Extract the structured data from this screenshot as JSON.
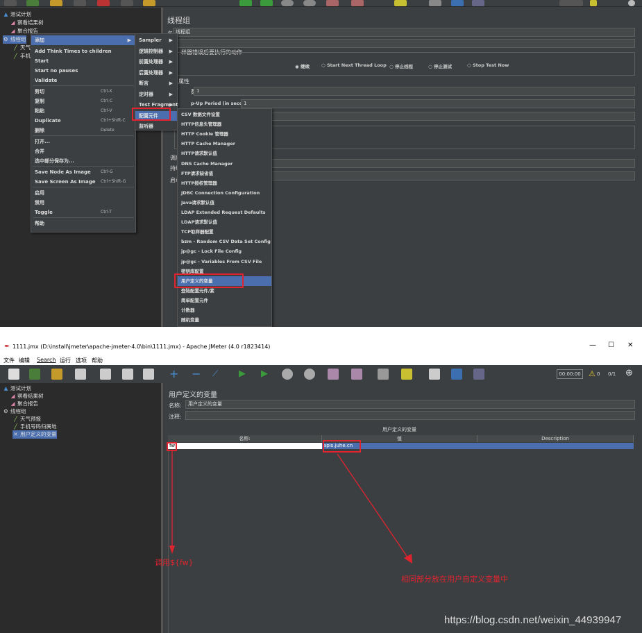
{
  "top": {
    "tree": [
      "测试计划",
      "察看结果树",
      "聚合报告",
      "线程组",
      "天气",
      "手机"
    ],
    "context_menu": {
      "items": [
        {
          "label": "添加",
          "shortcut": "",
          "submenu": true,
          "selected": true
        },
        {
          "label": "Add Think Times to children",
          "shortcut": ""
        },
        {
          "label": "Start",
          "shortcut": ""
        },
        {
          "label": "Start no pauses",
          "shortcut": ""
        },
        {
          "label": "Validate",
          "shortcut": ""
        },
        {
          "label": "剪切",
          "shortcut": "Ctrl-X"
        },
        {
          "label": "复制",
          "shortcut": "Ctrl-C"
        },
        {
          "label": "粘贴",
          "shortcut": "Ctrl-V"
        },
        {
          "label": "Duplicate",
          "shortcut": "Ctrl+Shift-C"
        },
        {
          "label": "删除",
          "shortcut": "Delete"
        },
        {
          "label": "打开...",
          "shortcut": ""
        },
        {
          "label": "合并",
          "shortcut": ""
        },
        {
          "label": "选中部分保存为...",
          "shortcut": ""
        },
        {
          "label": "Save Node As Image",
          "shortcut": "Ctrl-G"
        },
        {
          "label": "Save Screen As Image",
          "shortcut": "Ctrl+Shift-G"
        },
        {
          "label": "启用",
          "shortcut": ""
        },
        {
          "label": "禁用",
          "shortcut": ""
        },
        {
          "label": "Toggle",
          "shortcut": "Ctrl-T"
        },
        {
          "label": "帮助",
          "shortcut": ""
        }
      ]
    },
    "add_menu": [
      "Sampler",
      "逻辑控制器",
      "前置处理器",
      "后置处理器",
      "断言",
      "定时器",
      "Test Fragment",
      "配置元件",
      "监听器"
    ],
    "config_menu": [
      "CSV 数据文件设置",
      "HTTP信息头管理器",
      "HTTP Cookie 管理器",
      "HTTP Cache Manager",
      "HTTP请求默认值",
      "DNS Cache Manager",
      "FTP请求缺省值",
      "HTTP授权管理器",
      "JDBC Connection Configuration",
      "Java请求默认值",
      "LDAP Extended Request Defaults",
      "LDAP请求默认值",
      "TCP取样器配置",
      "bzm - Random CSV Data Set Config",
      "jp@gc - Lock File Config",
      "jp@gc - Variables From CSV File",
      "密钥库配置",
      "用户定义的变量",
      "登陆配置元件/素",
      "简单配置元件",
      "计数器",
      "随机变量"
    ],
    "panel": {
      "title": "线程组",
      "name_label": "名称:",
      "name_value": "线程组",
      "error_action_label": "样器错误后要执行的动作",
      "radios": [
        "继续",
        "Start Next Thread Loop",
        "停止线程",
        "停止测试",
        "Stop Test Now"
      ],
      "props_label": "属性",
      "threads_label": "数:",
      "threads_value": "1",
      "rampup_label": "p-Up Period (in seconds):",
      "rampup_value": "1",
      "partial": [
        "调度",
        "持续",
        "启动"
      ]
    }
  },
  "bottom": {
    "window_title": "1111.jmx (D:\\install\\jmeter\\apache-jmeter-4.0\\bin\\1111.jmx) - Apache JMeter (4.0 r1823414)",
    "window_controls": [
      "—",
      "☐",
      "✕"
    ],
    "menu": [
      "文件",
      "编辑",
      "Search",
      "运行",
      "选项",
      "帮助"
    ],
    "timer": "00:00:00",
    "warn_count": "0",
    "threads": "0/1",
    "tree": [
      "测试计划",
      "察看结果树",
      "聚合报告",
      "线程组",
      "天气预报",
      "手机号码归属地",
      "用户定义的变量"
    ],
    "panel": {
      "title": "用户定义的变量",
      "name_label": "名称:",
      "name_value": "用户定义的变量",
      "comment_label": "注释:",
      "table_title": "用户定义的变量",
      "columns": [
        "名称:",
        "值",
        "Description"
      ],
      "row": {
        "name": "fw",
        "value": "apis.juhe.cn",
        "description": ""
      }
    },
    "annotations": {
      "call": "调用${fw}",
      "note": "相同部分放在用户自定义变量中"
    },
    "watermark": "https://blog.csdn.net/weixin_44939947"
  },
  "colors": {
    "annotation": "#e0242f",
    "selection": "#4b6eaf",
    "bg": "#3c3f41"
  }
}
